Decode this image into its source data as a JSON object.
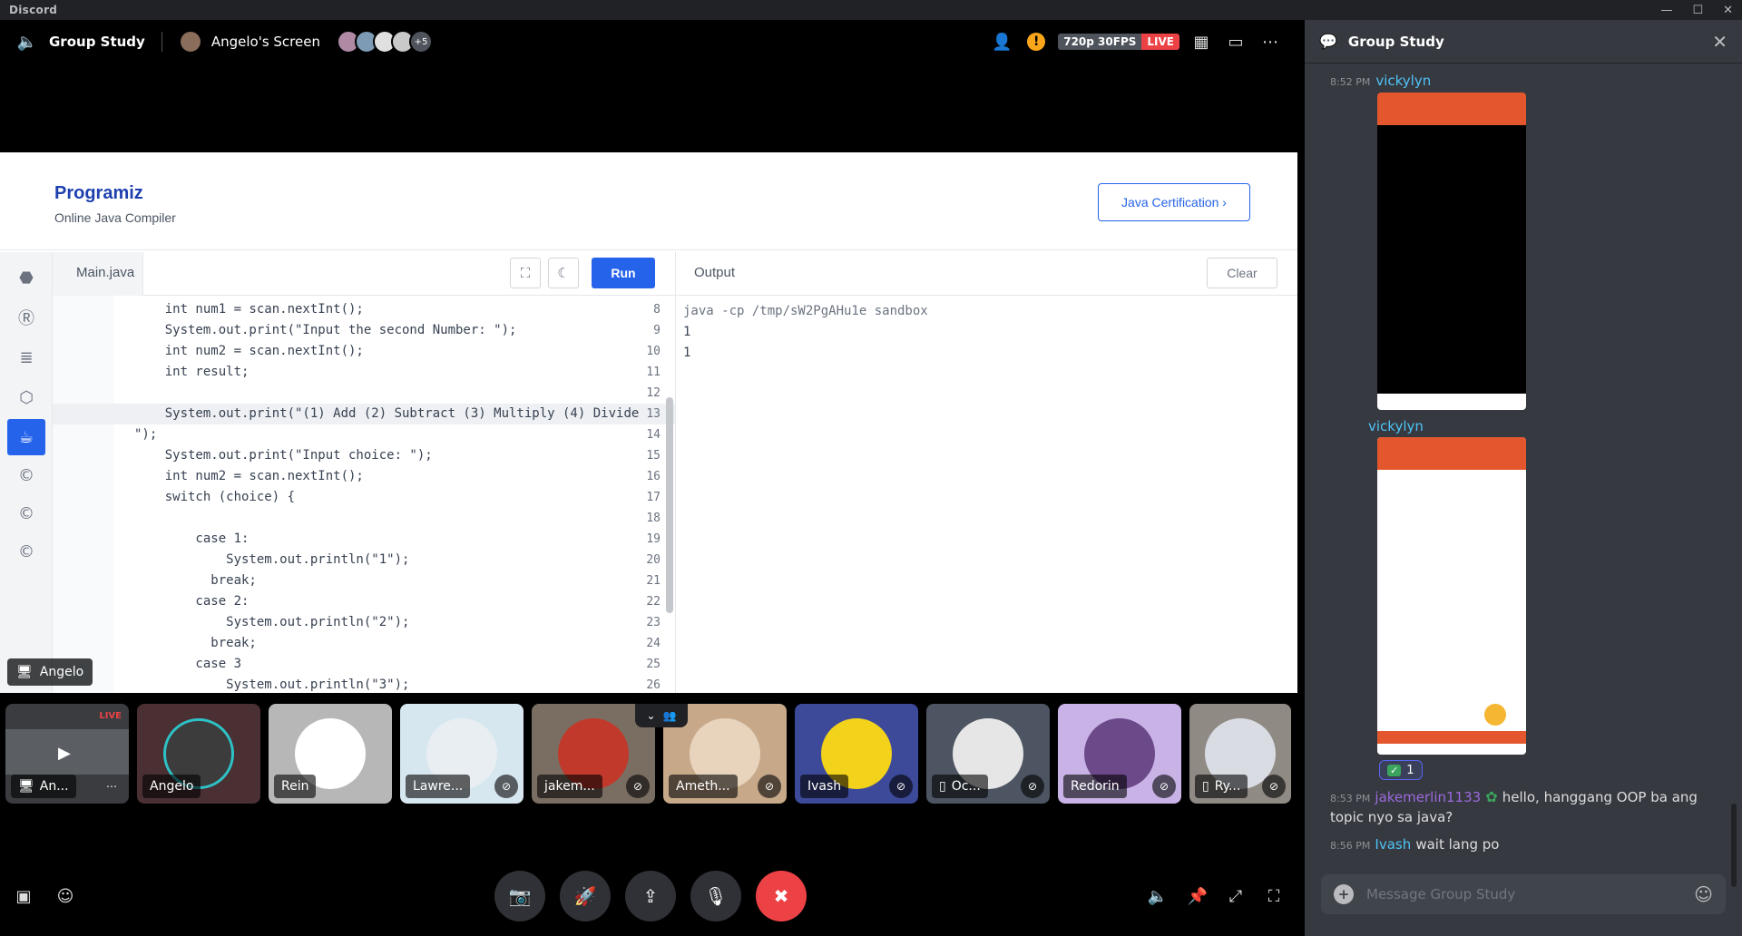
{
  "window": {
    "app_name": "Discord",
    "controls": [
      "—",
      "☐",
      "✕"
    ]
  },
  "voice_header": {
    "channel": "Group Study",
    "stream_title": "Angelo's Screen",
    "extra_viewers": "+5",
    "quality": "720p 30FPS",
    "live": "LIVE"
  },
  "programiz": {
    "logo": "Programiz",
    "subtitle": "Online Java Compiler",
    "cert_button": "Java Certification ›",
    "tab": "Main.java",
    "run": "Run",
    "output_title": "Output",
    "clear": "Clear",
    "code_lines": [
      {
        "n": "8",
        "t": "    int num1 = scan.nextInt();"
      },
      {
        "n": "9",
        "t": "    System.out.print(\"Input the second Number: \");"
      },
      {
        "n": "10",
        "t": "    int num2 = scan.nextInt();"
      },
      {
        "n": "11",
        "t": "    int result;"
      },
      {
        "n": "12",
        "t": ""
      },
      {
        "n": "13",
        "t": "    System.out.print(\"(1) Add (2) Subtract (3) Multiply (4) Divide"
      },
      {
        "n": "14",
        "t": "\");"
      },
      {
        "n": "15",
        "t": "    System.out.print(\"Input choice: \");"
      },
      {
        "n": "16",
        "t": "    int num2 = scan.nextInt();"
      },
      {
        "n": "17",
        "t": "    switch (choice) {"
      },
      {
        "n": "18",
        "t": ""
      },
      {
        "n": "19",
        "t": "        case 1:"
      },
      {
        "n": "20",
        "t": "            System.out.println(\"1\");"
      },
      {
        "n": "21",
        "t": "          break;"
      },
      {
        "n": "22",
        "t": "        case 2:"
      },
      {
        "n": "23",
        "t": "            System.out.println(\"2\");"
      },
      {
        "n": "24",
        "t": "          break;"
      },
      {
        "n": "25",
        "t": "        case 3"
      },
      {
        "n": "26",
        "t": "            System.out.println(\"3\");"
      }
    ],
    "output_lines": [
      "java -cp /tmp/sW2PgAHu1e sandbox",
      "1",
      "1"
    ]
  },
  "sharer_tag": "Angelo",
  "participants": [
    {
      "name": "An...",
      "live": "LIVE"
    },
    {
      "name": "Angelo"
    },
    {
      "name": "Rein"
    },
    {
      "name": "Lawre..."
    },
    {
      "name": "jakem..."
    },
    {
      "name": "Ameth..."
    },
    {
      "name": "Ivash"
    },
    {
      "name": "Oc..."
    },
    {
      "name": "Redorin"
    },
    {
      "name": "Ry..."
    }
  ],
  "chat": {
    "title": "Group Study",
    "messages": [
      {
        "time": "8:52 PM",
        "user": "vickylyn",
        "user_color": "#4fc3f7"
      },
      {
        "user": "vickylyn",
        "user_color": "#4fc3f7",
        "reaction": "1"
      },
      {
        "time": "8:53 PM",
        "user": "jakemerlin1133",
        "user_color": "#9c6ade",
        "text": "hello, hanggang OOP ba ang topic nyo sa java?"
      },
      {
        "time": "8:56 PM",
        "user": "Ivash",
        "user_color": "#4fc3f7",
        "text": "wait lang po"
      }
    ],
    "placeholder": "Message Group Study"
  },
  "colors": {
    "accent": "#5865f2",
    "live": "#ed4245",
    "run_button": "#2563eb",
    "disconnect": "#ed4245"
  }
}
